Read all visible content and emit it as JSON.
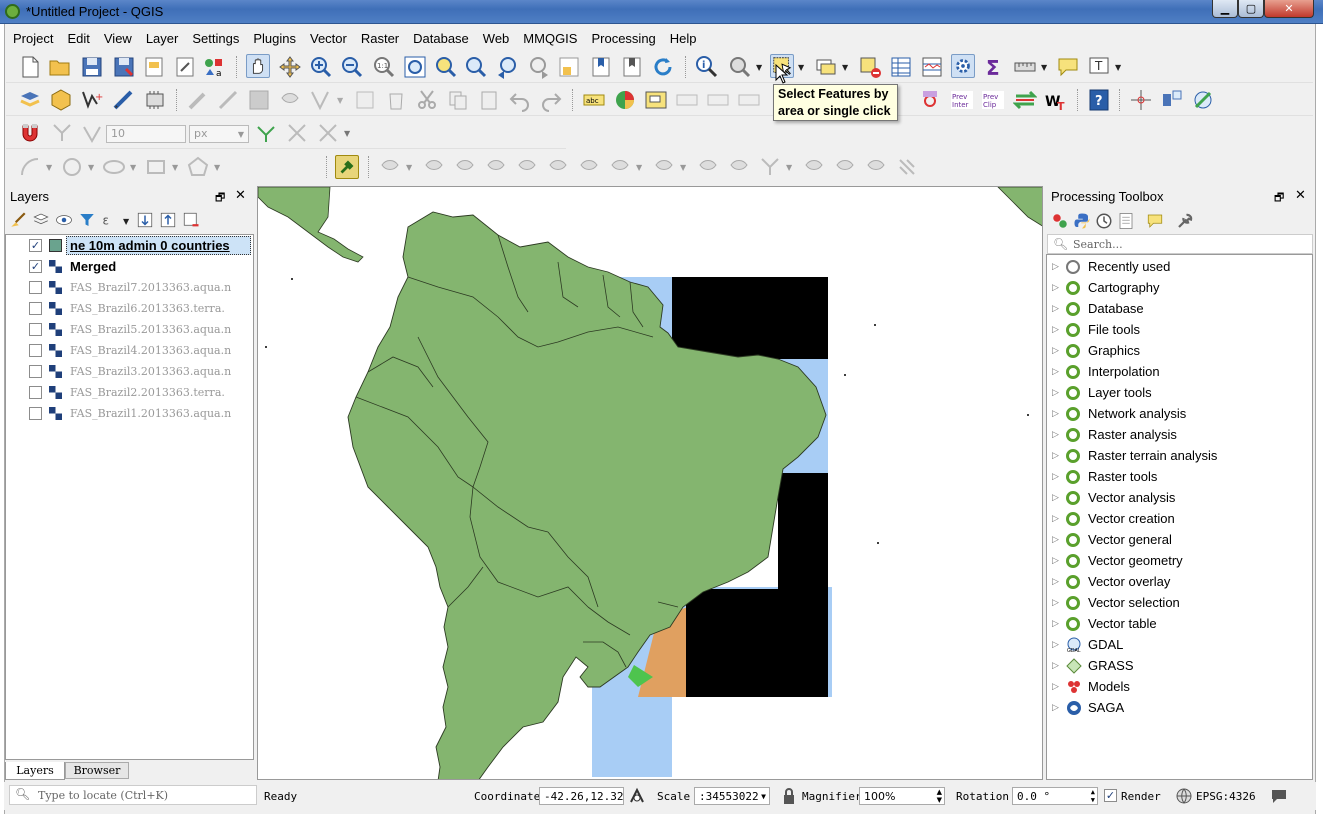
{
  "window": {
    "title": "*Untitled Project - QGIS"
  },
  "menu": [
    "Project",
    "Edit",
    "View",
    "Layer",
    "Settings",
    "Plugins",
    "Vector",
    "Raster",
    "Database",
    "Web",
    "MMQGIS",
    "Processing",
    "Help"
  ],
  "tooltip": {
    "line1": "Select Features by",
    "line2": "area or single click"
  },
  "digitize": {
    "tolerance_value": "10",
    "units": "px"
  },
  "layers_panel": {
    "title": "Layers",
    "layers": [
      {
        "name": "ne 10m admin 0 countries",
        "checked": true,
        "bold": true,
        "selected": true
      },
      {
        "name": "Merged",
        "checked": true,
        "bold": true
      },
      {
        "name": "FAS_Brazil7.2013363.aqua.n",
        "checked": false
      },
      {
        "name": "FAS_Brazil6.2013363.terra.",
        "checked": false
      },
      {
        "name": "FAS_Brazil5.2013363.aqua.n",
        "checked": false
      },
      {
        "name": "FAS_Brazil4.2013363.aqua.n",
        "checked": false
      },
      {
        "name": "FAS_Brazil3.2013363.aqua.n",
        "checked": false
      },
      {
        "name": "FAS_Brazil2.2013363.terra.",
        "checked": false
      },
      {
        "name": "FAS_Brazil1.2013363.aqua.n",
        "checked": false
      }
    ],
    "tabs": [
      "Layers",
      "Browser"
    ]
  },
  "toolbox": {
    "title": "Processing Toolbox",
    "search_placeholder": "Search...",
    "items": [
      "Recently used",
      "Cartography",
      "Database",
      "File tools",
      "Graphics",
      "Interpolation",
      "Layer tools",
      "Network analysis",
      "Raster analysis",
      "Raster terrain analysis",
      "Raster tools",
      "Vector analysis",
      "Vector creation",
      "Vector general",
      "Vector geometry",
      "Vector overlay",
      "Vector selection",
      "Vector table",
      "GDAL",
      "GRASS",
      "Models",
      "SAGA"
    ]
  },
  "status": {
    "locate_placeholder": "Type to locate (Ctrl+K)",
    "ready": "Ready",
    "coordinate_label": "Coordinate",
    "coordinate_value": "-42.26,12.32",
    "scale_label": "Scale",
    "scale_value": ":34553022",
    "magnifier_label": "Magnifier",
    "magnifier_value": "100%",
    "rotation_label": "Rotation",
    "rotation_value": "0.0 °",
    "render_label": "Render",
    "crs": "EPSG:4326"
  },
  "colors": {
    "land": "#84b56f",
    "water": "#a8cdf5",
    "raster_black": "#000000",
    "accent_tree": "#5aa02c"
  }
}
